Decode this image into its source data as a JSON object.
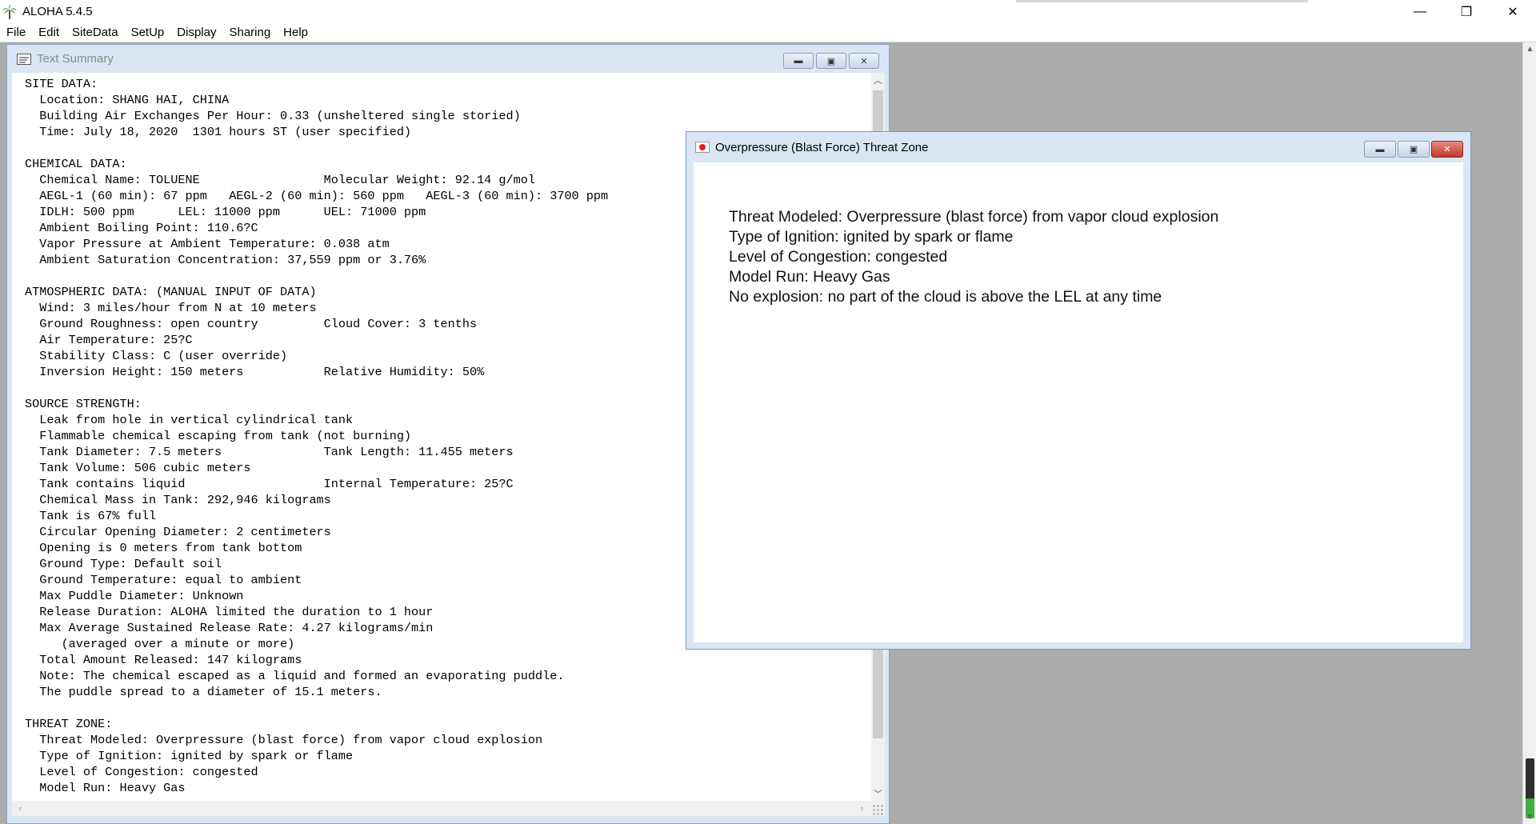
{
  "app": {
    "title": "ALOHA 5.4.5",
    "controls": {
      "minimize": "—",
      "restore": "❐",
      "close": "✕"
    }
  },
  "menu": [
    "File",
    "Edit",
    "SiteData",
    "SetUp",
    "Display",
    "Sharing",
    "Help"
  ],
  "text_summary": {
    "title": "Text Summary",
    "body": "SITE DATA:\n  Location: SHANG HAI, CHINA\n  Building Air Exchanges Per Hour: 0.33 (unsheltered single storied)\n  Time: July 18, 2020  1301 hours ST (user specified)\n\nCHEMICAL DATA:\n  Chemical Name: TOLUENE                 Molecular Weight: 92.14 g/mol\n  AEGL-1 (60 min): 67 ppm   AEGL-2 (60 min): 560 ppm   AEGL-3 (60 min): 3700 ppm\n  IDLH: 500 ppm      LEL: 11000 ppm      UEL: 71000 ppm\n  Ambient Boiling Point: 110.6?C\n  Vapor Pressure at Ambient Temperature: 0.038 atm\n  Ambient Saturation Concentration: 37,559 ppm or 3.76%\n\nATMOSPHERIC DATA: (MANUAL INPUT OF DATA)\n  Wind: 3 miles/hour from N at 10 meters\n  Ground Roughness: open country         Cloud Cover: 3 tenths\n  Air Temperature: 25?C\n  Stability Class: C (user override)\n  Inversion Height: 150 meters           Relative Humidity: 50%\n\nSOURCE STRENGTH:\n  Leak from hole in vertical cylindrical tank\n  Flammable chemical escaping from tank (not burning)\n  Tank Diameter: 7.5 meters              Tank Length: 11.455 meters\n  Tank Volume: 506 cubic meters\n  Tank contains liquid                   Internal Temperature: 25?C\n  Chemical Mass in Tank: 292,946 kilograms\n  Tank is 67% full\n  Circular Opening Diameter: 2 centimeters\n  Opening is 0 meters from tank bottom\n  Ground Type: Default soil\n  Ground Temperature: equal to ambient\n  Max Puddle Diameter: Unknown\n  Release Duration: ALOHA limited the duration to 1 hour\n  Max Average Sustained Release Rate: 4.27 kilograms/min\n     (averaged over a minute or more)\n  Total Amount Released: 147 kilograms\n  Note: The chemical escaped as a liquid and formed an evaporating puddle.\n  The puddle spread to a diameter of 15.1 meters.\n\nTHREAT ZONE:\n  Threat Modeled: Overpressure (blast force) from vapor cloud explosion\n  Type of Ignition: ignited by spark or flame\n  Level of Congestion: congested\n  Model Run: Heavy Gas"
  },
  "threat_zone": {
    "title": "Overpressure (Blast Force) Threat Zone",
    "lines": [
      "Threat Modeled: Overpressure (blast force) from vapor cloud explosion",
      "Type of Ignition: ignited by spark or flame",
      "Level of Congestion: congested",
      "Model Run: Heavy Gas",
      "No explosion: no part of the cloud is above the LEL at any time"
    ]
  },
  "icons": {
    "app": "palm-tree-icon",
    "text_summary": "text-document-icon",
    "threat_zone": "japan-flag-icon"
  },
  "colors": {
    "mdi_background": "#ababab",
    "mdi_frame": "#dae6f3",
    "close_button": "#c0392b"
  }
}
